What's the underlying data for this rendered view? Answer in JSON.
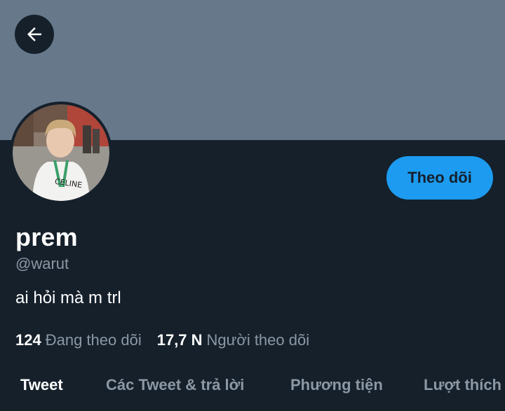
{
  "header": {
    "back_icon": "arrow-left-icon",
    "banner_color": "#66788a"
  },
  "profile": {
    "avatar_icon": "profile-photo",
    "display_name": "prem",
    "handle": "@warut",
    "bio": "ai hỏi mà m trl",
    "follow_label": "Theo dõi"
  },
  "stats": {
    "following_count": "124",
    "following_label": "Đang theo dõi",
    "followers_count": "17,7 N",
    "followers_label": "Người theo dõi"
  },
  "tabs": [
    {
      "label": "Tweet",
      "active": true
    },
    {
      "label": "Các Tweet & trả lời",
      "active": false
    },
    {
      "label": "Phương tiện",
      "active": false
    },
    {
      "label": "Lượt thích",
      "active": false
    }
  ],
  "colors": {
    "background": "#15202b",
    "accent": "#1d9bf0",
    "secondary_text": "#8b98a5"
  }
}
